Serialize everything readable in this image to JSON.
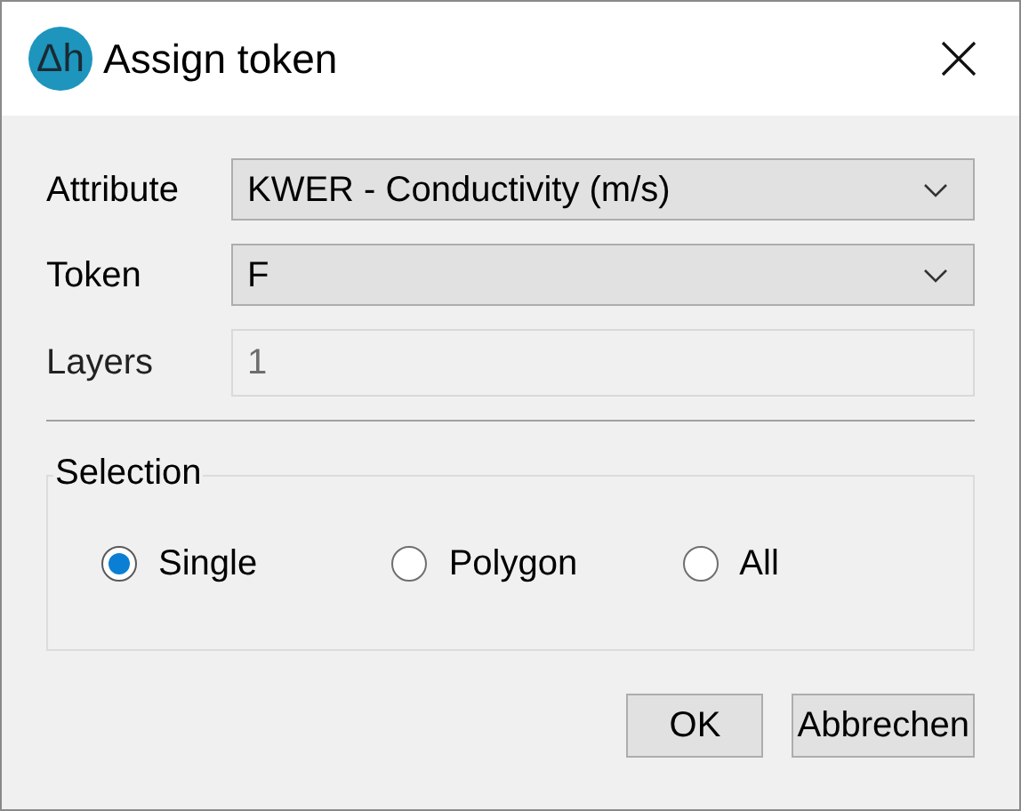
{
  "window": {
    "logo": "Δh",
    "title": "Assign token"
  },
  "fields": [
    {
      "kind": "dropdown",
      "label": "Attribute",
      "value": "KWER - Conductivity (m/s)",
      "disabled": false
    },
    {
      "kind": "dropdown",
      "label": "Token",
      "value": "F",
      "disabled": false
    },
    {
      "kind": "text",
      "label": "Layers",
      "value": "1",
      "disabled": true
    }
  ],
  "selection": {
    "title": "Selection",
    "options": [
      {
        "label": "Single",
        "selected": true
      },
      {
        "label": "Polygon",
        "selected": false
      },
      {
        "label": "All",
        "selected": false
      }
    ]
  },
  "buttons": [
    "OK",
    "Abbrechen"
  ]
}
